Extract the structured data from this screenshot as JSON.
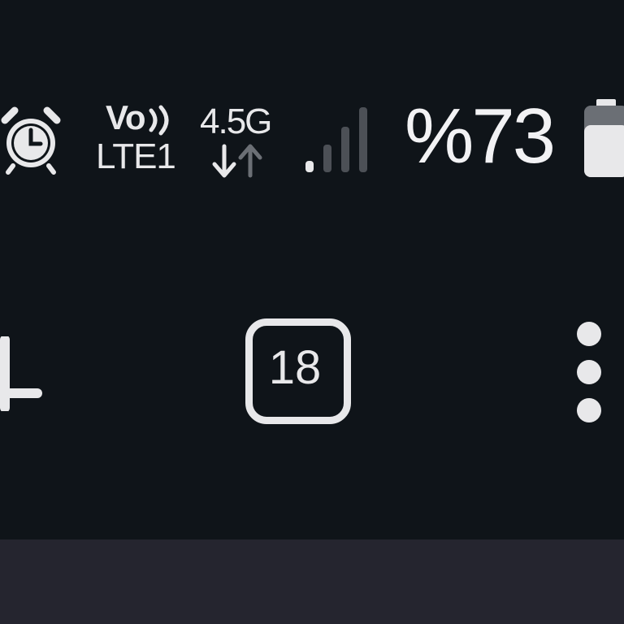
{
  "status_bar": {
    "alarm_icon": "alarm-clock-icon",
    "volte": {
      "top": "Vo",
      "bottom": "LTE1"
    },
    "network_type": "4.5G",
    "data_arrows_icon": "data-activity-icon",
    "signal_icon": "cell-signal-icon",
    "signal_level": 0.25,
    "battery_percent": "%73",
    "battery_icon": "battery-icon",
    "battery_level": 0.73
  },
  "toolbar": {
    "add_icon": "plus-icon",
    "tab_count": "18",
    "menu_icon": "more-vertical-icon"
  },
  "colors": {
    "background": "#0f1419",
    "foreground": "#e8e8ea",
    "dim": "#6b6f75",
    "bottom_panel": "#25252f"
  }
}
